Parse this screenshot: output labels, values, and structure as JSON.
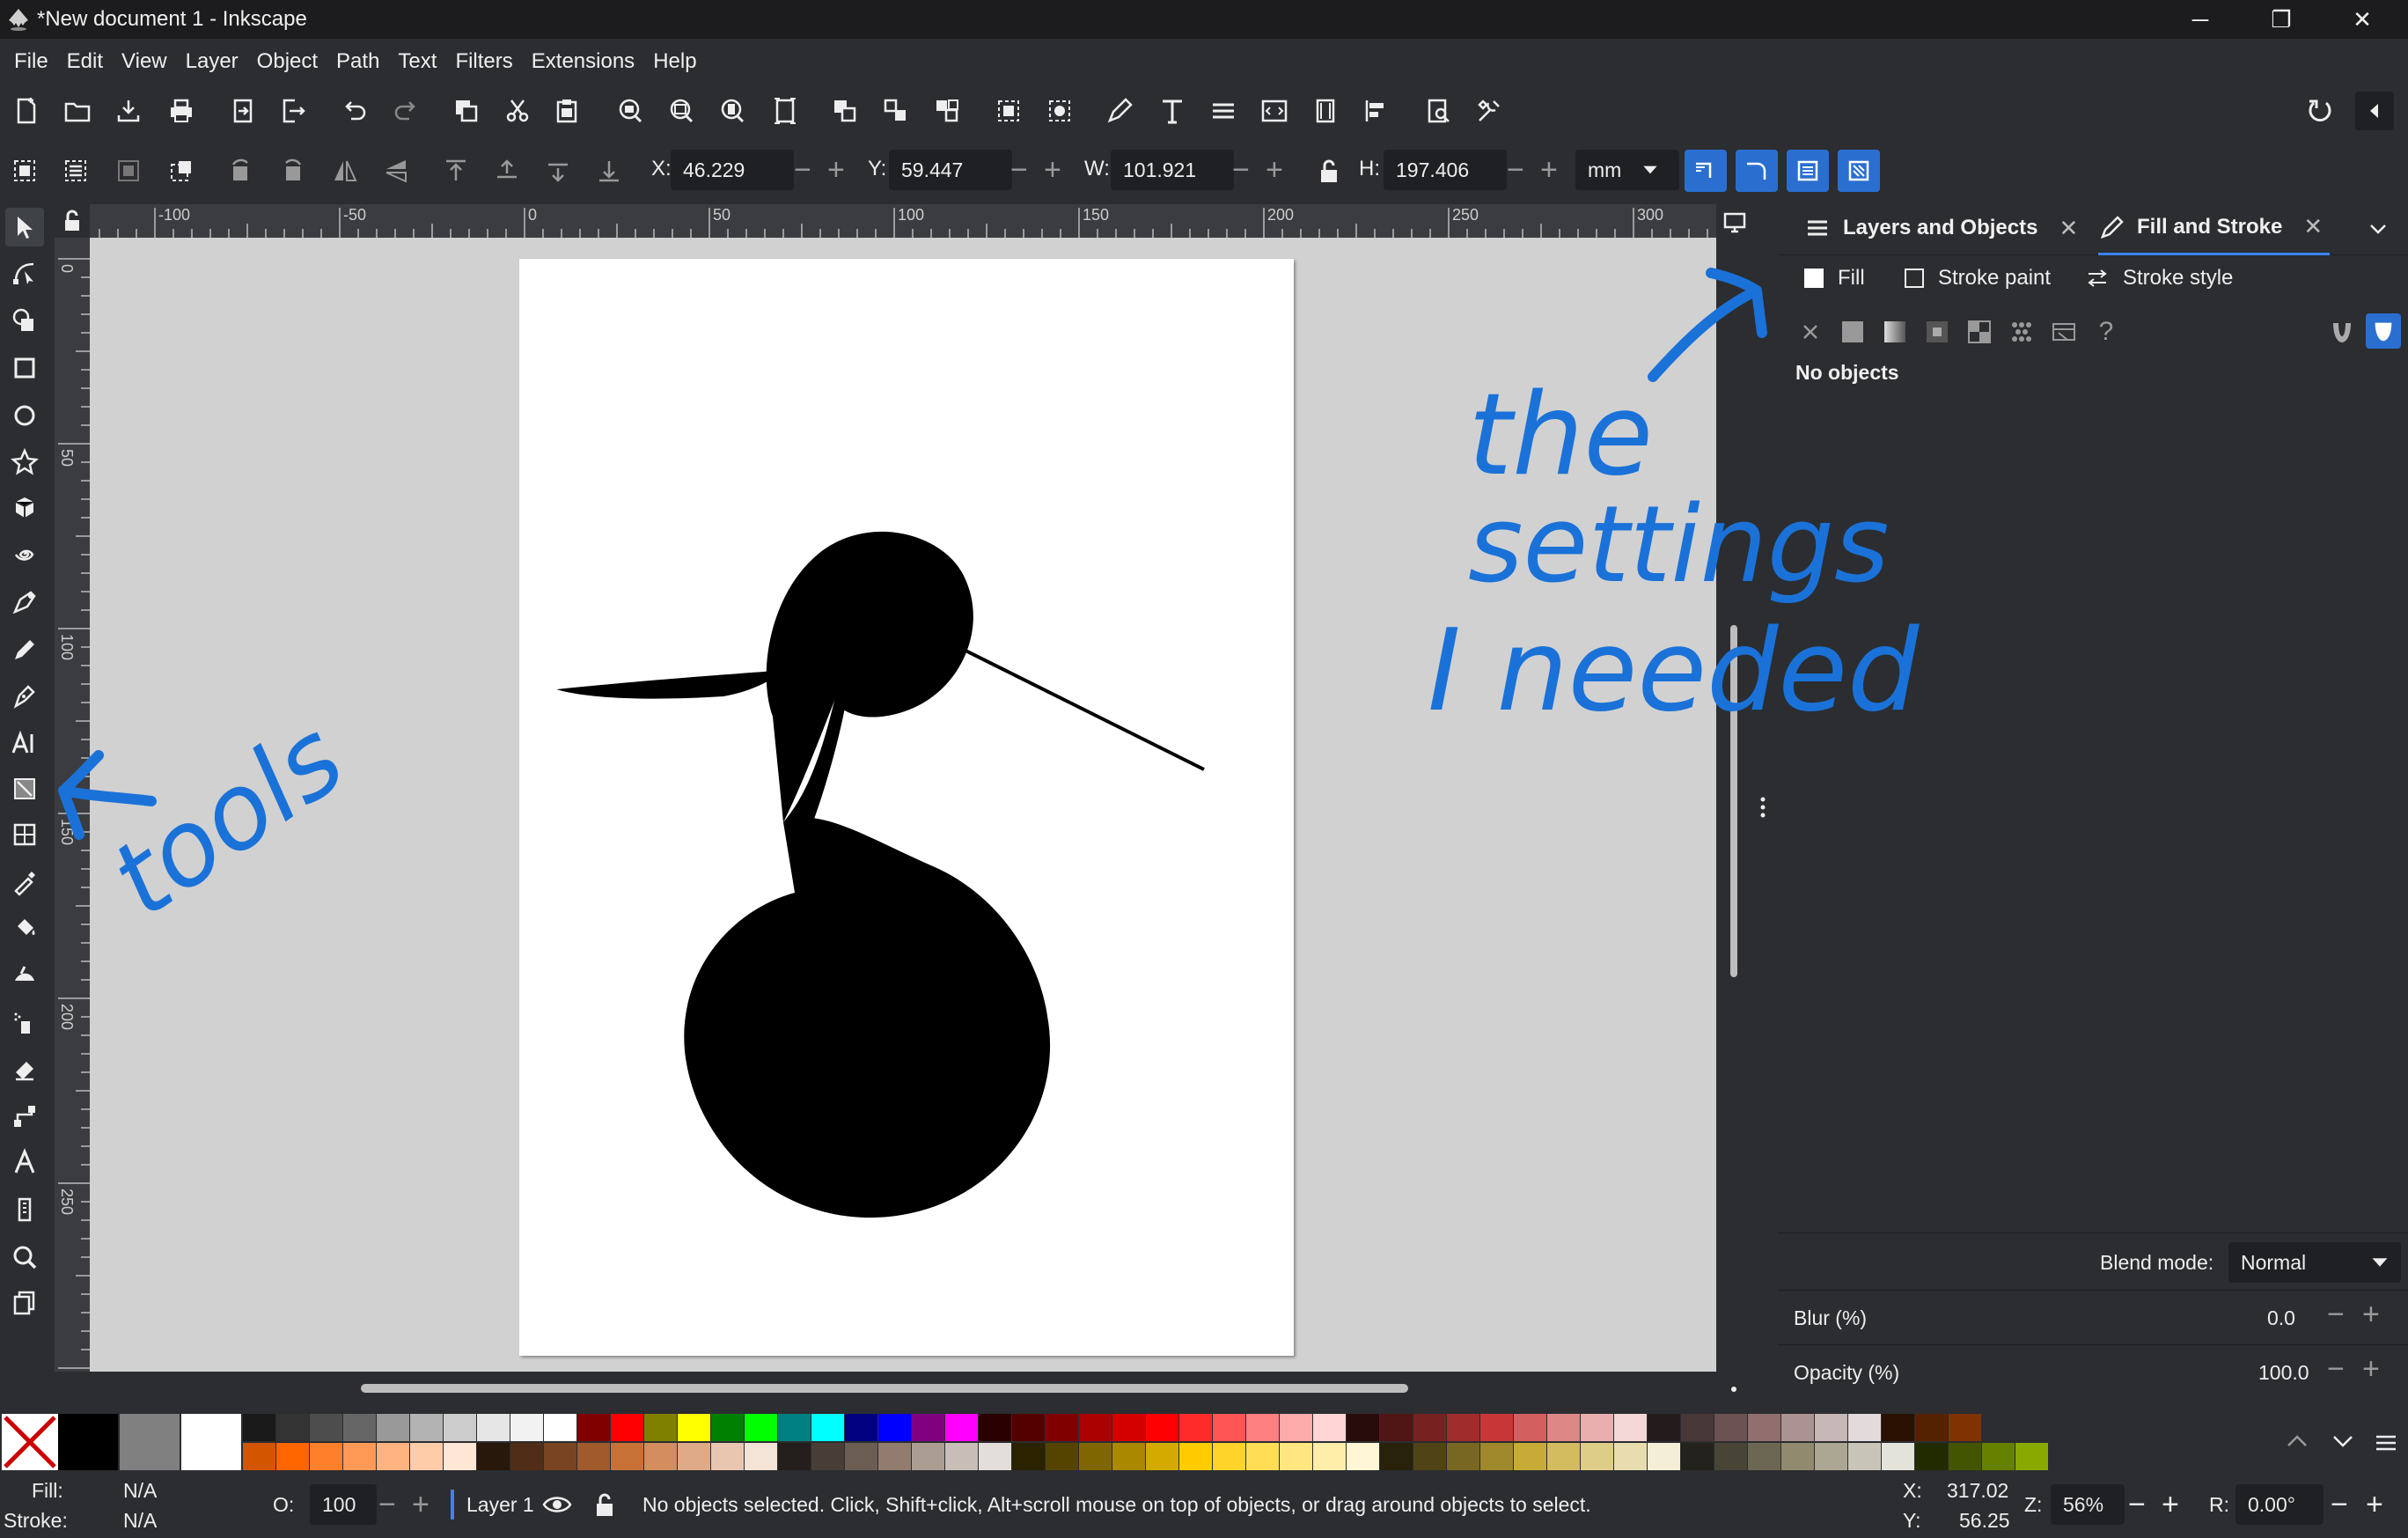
{
  "window": {
    "title": "*New document 1 - Inkscape",
    "minimize": "─",
    "maximize": "❐",
    "close": "✕"
  },
  "menu": [
    "File",
    "Edit",
    "View",
    "Layer",
    "Object",
    "Path",
    "Text",
    "Filters",
    "Extensions",
    "Help"
  ],
  "controls": {
    "x_label": "X:",
    "x_value": "46.229",
    "y_label": "Y:",
    "y_value": "59.447",
    "w_label": "W:",
    "w_value": "101.921",
    "h_label": "H:",
    "h_value": "197.406",
    "unit": "mm",
    "minus": "−",
    "plus": "+"
  },
  "ruler": {
    "h_labels": [
      "-100",
      "-50",
      "0",
      "50",
      "100",
      "150",
      "200",
      "250",
      "300"
    ],
    "v_labels": [
      "0",
      "50",
      "100",
      "150",
      "200",
      "250"
    ]
  },
  "dock": {
    "tabs": [
      {
        "label": "Layers and Objects"
      },
      {
        "label": "Fill and Stroke"
      }
    ],
    "close": "✕",
    "subtabs": [
      "Fill",
      "Stroke paint",
      "Stroke style"
    ],
    "question": "?",
    "no_objects": "No objects",
    "blend_label": "Blend mode:",
    "blend_value": "Normal",
    "blur_label": "Blur (%)",
    "blur_value": "0.0",
    "opacity_label": "Opacity (%)",
    "opacity_value": "100.0"
  },
  "palette": {
    "row1": [
      "#000000",
      "#808080",
      "#ffffff",
      "#1a1a1a",
      "#333333",
      "#4d4d4d",
      "#666666",
      "#999999",
      "#b3b3b3",
      "#cccccc",
      "#e6e6e6",
      "#f2f2f2",
      "#ffffff",
      "#800000",
      "#ff0000",
      "#808000",
      "#ffff00",
      "#008000",
      "#00ff00",
      "#008080",
      "#00ffff",
      "#000080",
      "#0000ff",
      "#800080",
      "#ff00ff",
      "#2b0000",
      "#550000",
      "#800000",
      "#aa0000",
      "#d40000",
      "#ff0000",
      "#ff2a2a",
      "#ff5555",
      "#ff8080",
      "#ffaaaa",
      "#ffd5d5",
      "#280b0b",
      "#501616",
      "#782121",
      "#a02c2c",
      "#c83737",
      "#d35f5f",
      "#de8787",
      "#e9afaf",
      "#f4d7d7",
      "#241c1c",
      "#483737",
      "#6c5353",
      "#916f6f",
      "#ac9393",
      "#c8b7b7",
      "#e3dbdb",
      "#2b1100",
      "#552200",
      "#803300"
    ],
    "row2": [
      "#d45500",
      "#ff6600",
      "#ff7f2a",
      "#ff9955",
      "#ffb380",
      "#ffccaa",
      "#ffe6d5",
      "#28170b",
      "#502d16",
      "#784421",
      "#a05a2c",
      "#c87137",
      "#d38d5f",
      "#deaa87",
      "#e9c6af",
      "#f4e3d7",
      "#241f1c",
      "#483e37",
      "#6c5d53",
      "#917c6f",
      "#ac9d93",
      "#c8beb7",
      "#e3dedb",
      "#2b2200",
      "#554400",
      "#806600",
      "#aa8800",
      "#d4aa00",
      "#ffcc00",
      "#ffd42a",
      "#ffdd55",
      "#ffe680",
      "#ffeeaa",
      "#fff6d5",
      "#28220b",
      "#504416",
      "#786721",
      "#a0892c",
      "#c8ab37",
      "#d3bc5f",
      "#decd87",
      "#e9ddaf",
      "#f4eed7",
      "#24221c",
      "#484537",
      "#6c6753",
      "#918a6f",
      "#aca793",
      "#c8c4b7",
      "#e3e2db",
      "#222b00",
      "#445500",
      "#668000",
      "#88aa00"
    ]
  },
  "status": {
    "fill_label": "Fill:",
    "fill_value": "N/A",
    "stroke_label": "Stroke:",
    "stroke_value": "N/A",
    "opacity_label": "O:",
    "opacity_value": "100",
    "layer": "Layer 1",
    "message": "No objects selected. Click, Shift+click, Alt+scroll mouse on top of objects, or drag around objects to select.",
    "x_label": "X:",
    "x_value": "317.02",
    "y_label": "Y:",
    "y_value": "56.25",
    "zoom_label": "Z:",
    "zoom_value": "56%",
    "rot_label": "R:",
    "rot_value": "0.00°"
  },
  "annotations": {
    "tools_note": "tools",
    "settings_note": [
      "the",
      "settings",
      "I needed"
    ],
    "ink_color": "#1a72d9"
  }
}
